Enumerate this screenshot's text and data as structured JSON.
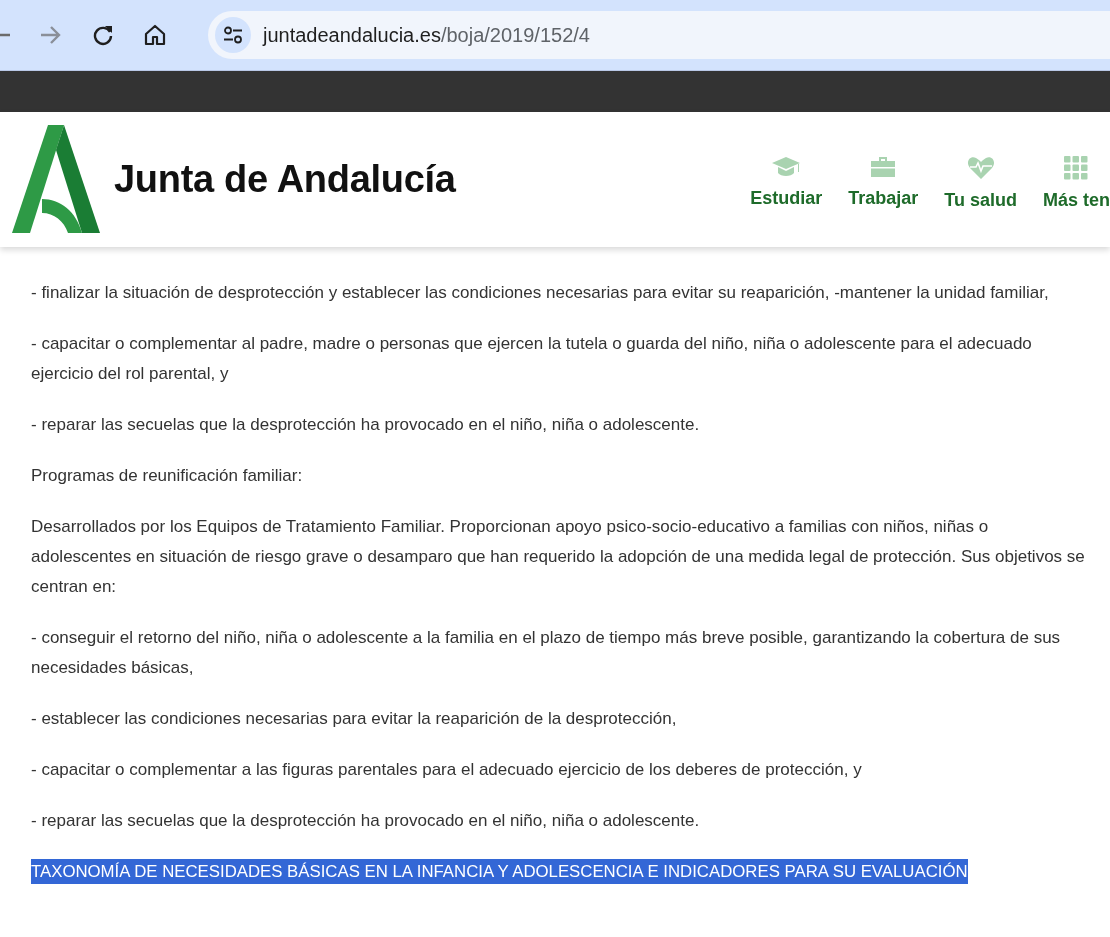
{
  "browser": {
    "url_host": "juntadeandalucia.es",
    "url_path": "/boja/2019/152/4"
  },
  "header": {
    "logo_text": "Junta de Andalucía",
    "nav": [
      {
        "label": "Estudiar",
        "kind": "cap"
      },
      {
        "label": "Trabajar",
        "kind": "briefcase"
      },
      {
        "label": "Tu salud",
        "kind": "heart"
      },
      {
        "label": "Más ten",
        "kind": "grid"
      }
    ]
  },
  "content": {
    "paragraphs": [
      "- finalizar la situación de desprotección y establecer las condiciones necesarias para evitar su reaparición, -mantener la unidad familiar,",
      "- capacitar o complementar al padre, madre o personas que ejercen la tutela o guarda del niño, niña o adolescente para el adecuado ejercicio del rol parental, y",
      "- reparar las secuelas que la desprotección ha provocado en el niño, niña o adolescente.",
      "Programas de reunificación familiar:",
      "Desarrollados por los Equipos de Tratamiento Familiar. Proporcionan apoyo psico-socio-educativo a familias con niños, niñas o adolescentes en situación de riesgo grave o desamparo que han requerido la adopción de una medida legal de protección. Sus objetivos se centran en:",
      "- conseguir el retorno del niño, niña o adolescente a la familia en el plazo de tiempo más breve posible, garantizando la cobertura de sus necesidades básicas,",
      "- establecer las condiciones necesarias para evitar la reaparición de la desprotección,",
      "- capacitar o complementar a las figuras parentales para el adecuado ejercicio de los deberes de protección, y",
      "- reparar las secuelas que la desprotección ha provocado en el niño, niña o adolescente."
    ],
    "heading": {
      "text": "TAXONOMÍA DE NECESIDADES BÁSICAS EN LA INFANCIA Y ADOLESCENCIA E INDICADORES PARA SU EVALUACIÓN",
      "selected": true
    }
  }
}
